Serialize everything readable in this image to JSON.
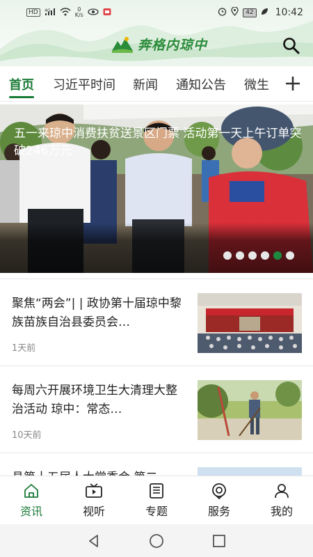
{
  "status_bar": {
    "speed_value": "0",
    "speed_unit": "K/s",
    "network": "4G",
    "battery": "42",
    "time": "10:42"
  },
  "header": {
    "logo_text": "奔格内琼中",
    "search_icon": "search-icon"
  },
  "tabs": [
    {
      "label": "首页",
      "active": true
    },
    {
      "label": "习近平时间",
      "active": false
    },
    {
      "label": "新闻",
      "active": false
    },
    {
      "label": "通知公告",
      "active": false
    },
    {
      "label": "微生",
      "active": false
    }
  ],
  "tab_add_icon": "plus-icon",
  "banner": {
    "title": "五一来琼中消费扶贫送景区门票 活动第一天上午订单突破246万元",
    "dots_total": 6,
    "active_dot": 5
  },
  "news": [
    {
      "title": "聚焦“两会”| | 政协第十届琼中黎族苗族自治县委员会…",
      "time": "1天前"
    },
    {
      "title": "每周六开展环境卫生大清理大整治活动 琼中：常态…",
      "time": "10天前"
    },
    {
      "title": "县第十五届人大常委会 第二",
      "time": ""
    }
  ],
  "bottom_nav": [
    {
      "label": "资讯",
      "icon": "home-icon",
      "active": true
    },
    {
      "label": "视听",
      "icon": "video-icon",
      "active": false
    },
    {
      "label": "专题",
      "icon": "newspaper-icon",
      "active": false
    },
    {
      "label": "服务",
      "icon": "service-icon",
      "active": false
    },
    {
      "label": "我的",
      "icon": "user-icon",
      "active": false
    }
  ],
  "system_nav": [
    "back-icon",
    "home-circle-icon",
    "recents-icon"
  ],
  "colors": {
    "accent": "#1a7a37",
    "active_dot": "#1f8a3f",
    "logo_green": "#2a8b3a"
  }
}
